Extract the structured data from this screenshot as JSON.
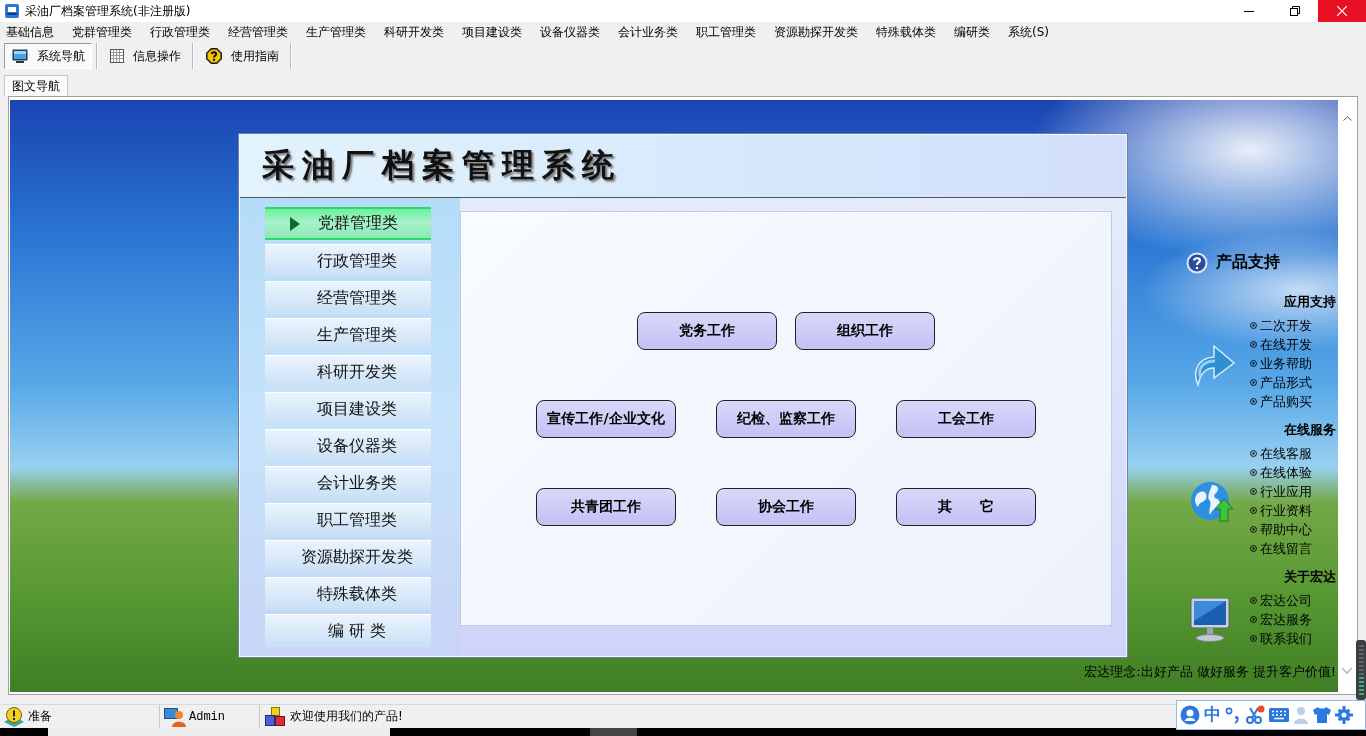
{
  "window": {
    "title": "采油厂档案管理系统(非注册版)"
  },
  "menu": [
    "基础信息",
    "党群管理类",
    "行政管理类",
    "经营管理类",
    "生产管理类",
    "科研开发类",
    "项目建设类",
    "设备仪器类",
    "会计业务类",
    "职工管理类",
    "资源勘探开发类",
    "特殊载体类",
    "编研类",
    "系统(S)"
  ],
  "toolbar": [
    {
      "label": "系统导航",
      "selected": true
    },
    {
      "label": "信息操作",
      "selected": false
    },
    {
      "label": "使用指南",
      "selected": false
    }
  ],
  "tabs": [
    {
      "label": "图文导航",
      "selected": true
    }
  ],
  "panel": {
    "title": "采油厂档案管理系统",
    "nav": [
      {
        "label": "党群管理类",
        "selected": true
      },
      {
        "label": "行政管理类",
        "selected": false
      },
      {
        "label": "经营管理类",
        "selected": false
      },
      {
        "label": "生产管理类",
        "selected": false
      },
      {
        "label": "科研开发类",
        "selected": false
      },
      {
        "label": "项目建设类",
        "selected": false
      },
      {
        "label": "设备仪器类",
        "selected": false
      },
      {
        "label": "会计业务类",
        "selected": false
      },
      {
        "label": "职工管理类",
        "selected": false
      },
      {
        "label": "资源勘探开发类",
        "selected": false
      },
      {
        "label": "特殊载体类",
        "selected": false
      },
      {
        "label": "编 研 类",
        "selected": false
      }
    ],
    "button_rows": [
      [
        "党务工作",
        "组织工作"
      ],
      [
        "宣传工作/企业文化",
        "纪检、监察工作",
        "工会工作"
      ],
      [
        "共青团工作",
        "协会工作",
        "其　　它"
      ]
    ]
  },
  "support": {
    "title": "产品支持",
    "sections": [
      {
        "title": "应用支持",
        "links": [
          "二次开发",
          "在线开发",
          "业务帮助",
          "产品形式",
          "产品购买"
        ]
      },
      {
        "title": "在线服务",
        "links": [
          "在线客服",
          "在线体验",
          "行业应用",
          "行业资料",
          "帮助中心",
          "在线留言"
        ]
      },
      {
        "title": "关于宏达",
        "links": [
          "宏达公司",
          "宏达服务",
          "联系我们"
        ]
      }
    ],
    "slogan": "宏达理念:出好产品 做好服务 提升客户价值!"
  },
  "status_bar": [
    "准备",
    "Admin",
    "欢迎使用我们的产品!"
  ],
  "ime_toolbar": {
    "language": "中"
  }
}
